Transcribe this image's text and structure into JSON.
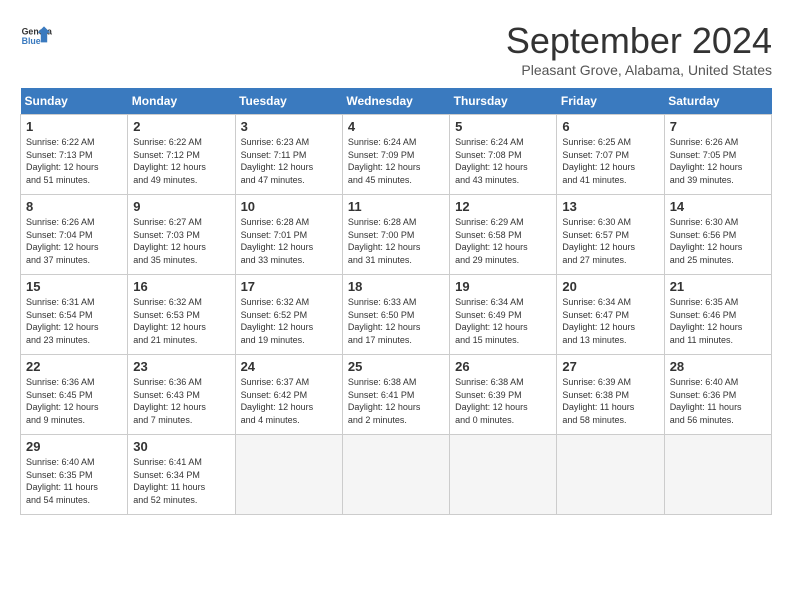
{
  "header": {
    "logo_line1": "General",
    "logo_line2": "Blue",
    "month": "September 2024",
    "location": "Pleasant Grove, Alabama, United States"
  },
  "weekdays": [
    "Sunday",
    "Monday",
    "Tuesday",
    "Wednesday",
    "Thursday",
    "Friday",
    "Saturday"
  ],
  "weeks": [
    [
      {
        "day": "1",
        "info": "Sunrise: 6:22 AM\nSunset: 7:13 PM\nDaylight: 12 hours\nand 51 minutes."
      },
      {
        "day": "2",
        "info": "Sunrise: 6:22 AM\nSunset: 7:12 PM\nDaylight: 12 hours\nand 49 minutes."
      },
      {
        "day": "3",
        "info": "Sunrise: 6:23 AM\nSunset: 7:11 PM\nDaylight: 12 hours\nand 47 minutes."
      },
      {
        "day": "4",
        "info": "Sunrise: 6:24 AM\nSunset: 7:09 PM\nDaylight: 12 hours\nand 45 minutes."
      },
      {
        "day": "5",
        "info": "Sunrise: 6:24 AM\nSunset: 7:08 PM\nDaylight: 12 hours\nand 43 minutes."
      },
      {
        "day": "6",
        "info": "Sunrise: 6:25 AM\nSunset: 7:07 PM\nDaylight: 12 hours\nand 41 minutes."
      },
      {
        "day": "7",
        "info": "Sunrise: 6:26 AM\nSunset: 7:05 PM\nDaylight: 12 hours\nand 39 minutes."
      }
    ],
    [
      {
        "day": "8",
        "info": "Sunrise: 6:26 AM\nSunset: 7:04 PM\nDaylight: 12 hours\nand 37 minutes."
      },
      {
        "day": "9",
        "info": "Sunrise: 6:27 AM\nSunset: 7:03 PM\nDaylight: 12 hours\nand 35 minutes."
      },
      {
        "day": "10",
        "info": "Sunrise: 6:28 AM\nSunset: 7:01 PM\nDaylight: 12 hours\nand 33 minutes."
      },
      {
        "day": "11",
        "info": "Sunrise: 6:28 AM\nSunset: 7:00 PM\nDaylight: 12 hours\nand 31 minutes."
      },
      {
        "day": "12",
        "info": "Sunrise: 6:29 AM\nSunset: 6:58 PM\nDaylight: 12 hours\nand 29 minutes."
      },
      {
        "day": "13",
        "info": "Sunrise: 6:30 AM\nSunset: 6:57 PM\nDaylight: 12 hours\nand 27 minutes."
      },
      {
        "day": "14",
        "info": "Sunrise: 6:30 AM\nSunset: 6:56 PM\nDaylight: 12 hours\nand 25 minutes."
      }
    ],
    [
      {
        "day": "15",
        "info": "Sunrise: 6:31 AM\nSunset: 6:54 PM\nDaylight: 12 hours\nand 23 minutes."
      },
      {
        "day": "16",
        "info": "Sunrise: 6:32 AM\nSunset: 6:53 PM\nDaylight: 12 hours\nand 21 minutes."
      },
      {
        "day": "17",
        "info": "Sunrise: 6:32 AM\nSunset: 6:52 PM\nDaylight: 12 hours\nand 19 minutes."
      },
      {
        "day": "18",
        "info": "Sunrise: 6:33 AM\nSunset: 6:50 PM\nDaylight: 12 hours\nand 17 minutes."
      },
      {
        "day": "19",
        "info": "Sunrise: 6:34 AM\nSunset: 6:49 PM\nDaylight: 12 hours\nand 15 minutes."
      },
      {
        "day": "20",
        "info": "Sunrise: 6:34 AM\nSunset: 6:47 PM\nDaylight: 12 hours\nand 13 minutes."
      },
      {
        "day": "21",
        "info": "Sunrise: 6:35 AM\nSunset: 6:46 PM\nDaylight: 12 hours\nand 11 minutes."
      }
    ],
    [
      {
        "day": "22",
        "info": "Sunrise: 6:36 AM\nSunset: 6:45 PM\nDaylight: 12 hours\nand 9 minutes."
      },
      {
        "day": "23",
        "info": "Sunrise: 6:36 AM\nSunset: 6:43 PM\nDaylight: 12 hours\nand 7 minutes."
      },
      {
        "day": "24",
        "info": "Sunrise: 6:37 AM\nSunset: 6:42 PM\nDaylight: 12 hours\nand 4 minutes."
      },
      {
        "day": "25",
        "info": "Sunrise: 6:38 AM\nSunset: 6:41 PM\nDaylight: 12 hours\nand 2 minutes."
      },
      {
        "day": "26",
        "info": "Sunrise: 6:38 AM\nSunset: 6:39 PM\nDaylight: 12 hours\nand 0 minutes."
      },
      {
        "day": "27",
        "info": "Sunrise: 6:39 AM\nSunset: 6:38 PM\nDaylight: 11 hours\nand 58 minutes."
      },
      {
        "day": "28",
        "info": "Sunrise: 6:40 AM\nSunset: 6:36 PM\nDaylight: 11 hours\nand 56 minutes."
      }
    ],
    [
      {
        "day": "29",
        "info": "Sunrise: 6:40 AM\nSunset: 6:35 PM\nDaylight: 11 hours\nand 54 minutes."
      },
      {
        "day": "30",
        "info": "Sunrise: 6:41 AM\nSunset: 6:34 PM\nDaylight: 11 hours\nand 52 minutes."
      },
      {
        "day": "",
        "info": ""
      },
      {
        "day": "",
        "info": ""
      },
      {
        "day": "",
        "info": ""
      },
      {
        "day": "",
        "info": ""
      },
      {
        "day": "",
        "info": ""
      }
    ]
  ]
}
